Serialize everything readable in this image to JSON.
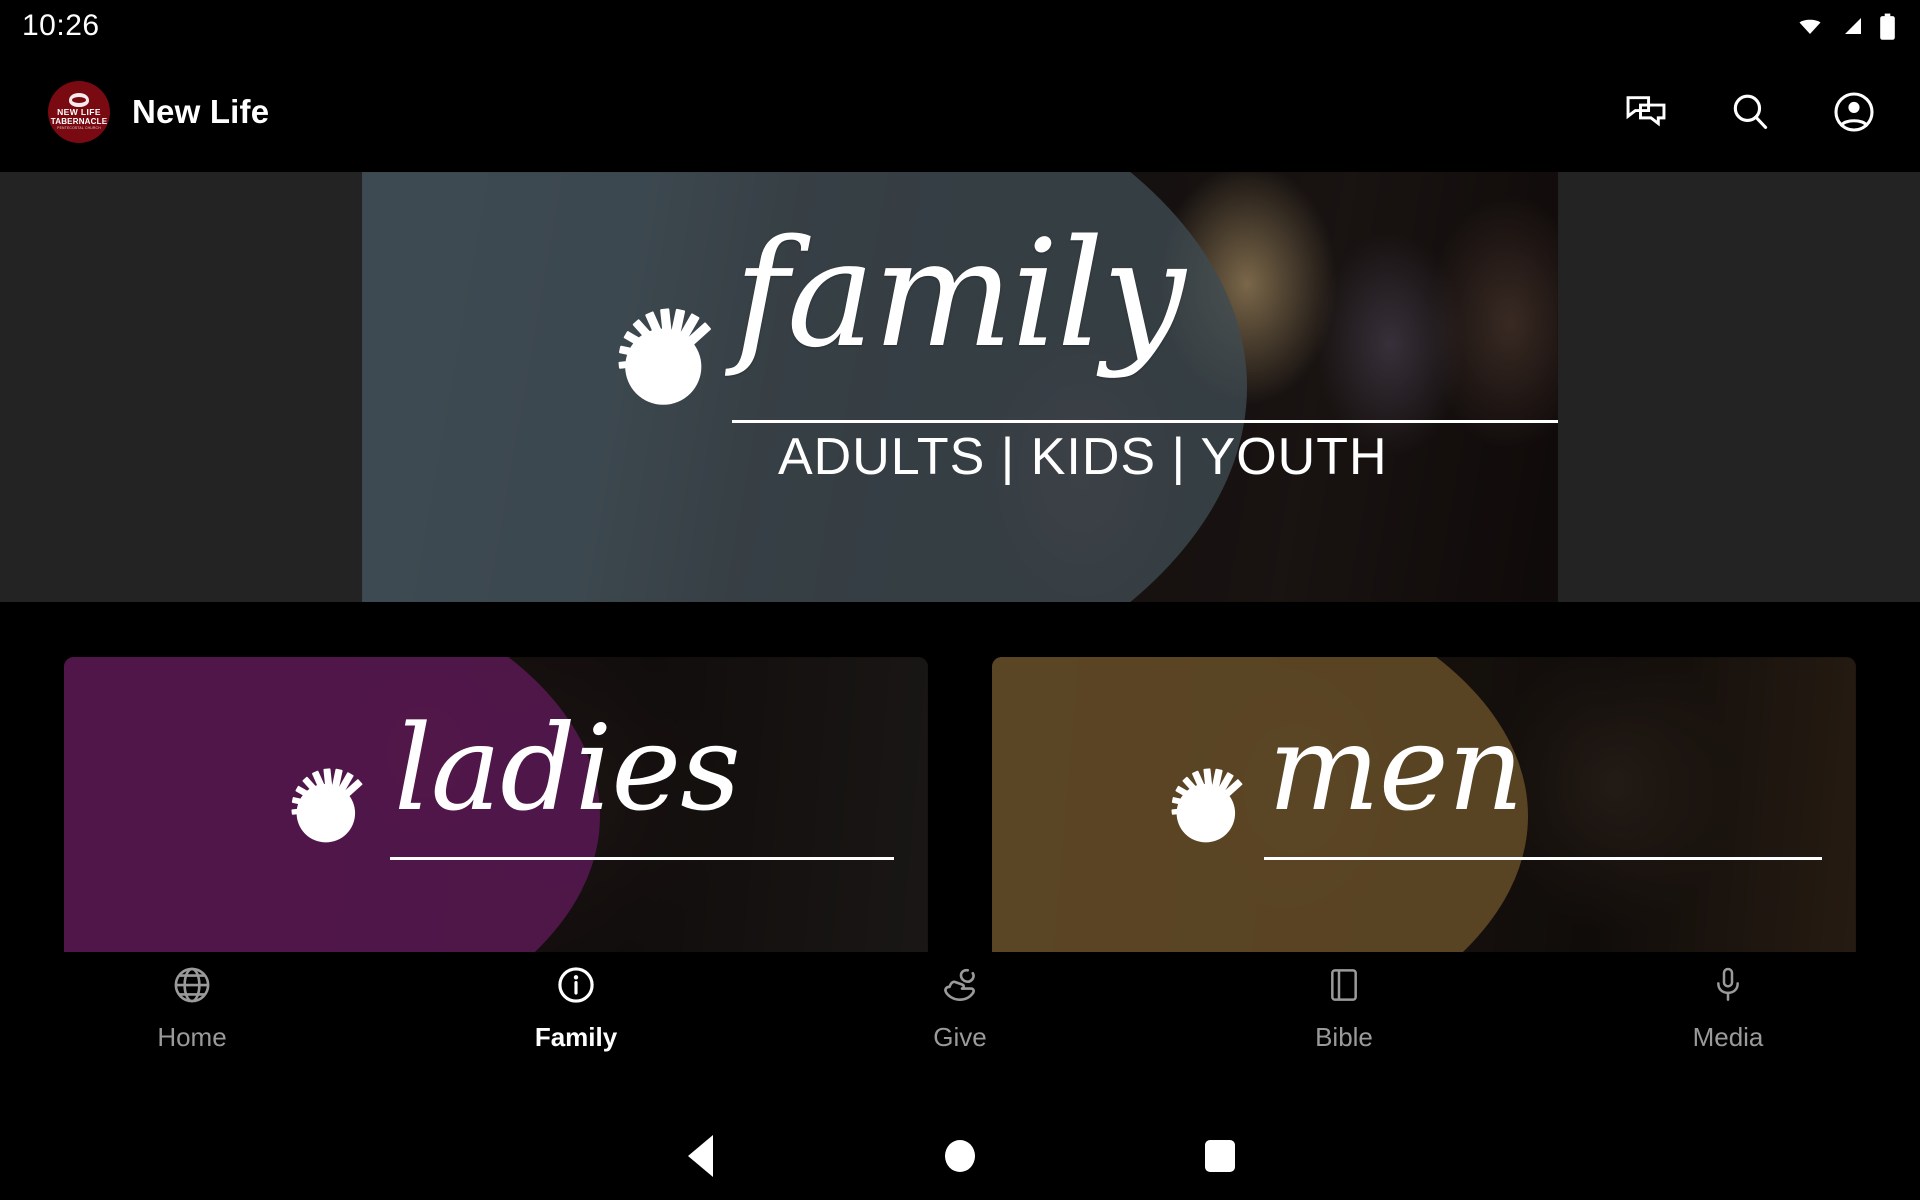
{
  "status_bar": {
    "time": "10:26",
    "icons": [
      "wifi-icon",
      "cellular-signal-icon",
      "battery-icon"
    ]
  },
  "app_bar": {
    "logo": {
      "name": "new-life-tabernacle-logo",
      "line1": "NEW LIFE",
      "line2": "TABERNACLE",
      "line3": "PENTECOSTAL CHURCH",
      "color": "#7A0A12"
    },
    "title": "New Life",
    "actions": [
      {
        "name": "chat-icon",
        "label": "Chat"
      },
      {
        "name": "search-icon",
        "label": "Search"
      },
      {
        "name": "account-circle-icon",
        "label": "Account"
      }
    ]
  },
  "hero": {
    "name": "family-banner",
    "script_title": "family",
    "subtitle": "ADULTS | KIDS | YOUTH",
    "overlay_color": "#5a6b76",
    "background_color": "#232323"
  },
  "cards": [
    {
      "name": "ladies-card",
      "script_title": "ladies",
      "tint_color": "#7b2270"
    },
    {
      "name": "men-card",
      "script_title": "men",
      "tint_color": "#8a6937"
    }
  ],
  "bottom_nav": {
    "items": [
      {
        "label": "Home",
        "icon": "globe-icon",
        "active": false
      },
      {
        "label": "Family",
        "icon": "info-circle-icon",
        "active": true
      },
      {
        "label": "Give",
        "icon": "giving-hand-icon",
        "active": false
      },
      {
        "label": "Bible",
        "icon": "book-icon",
        "active": false
      },
      {
        "label": "Media",
        "icon": "microphone-icon",
        "active": false
      }
    ],
    "active_color": "#ffffff",
    "inactive_color": "#9a9a9a"
  },
  "system_nav": {
    "back": "back-triangle-icon",
    "home": "home-circle-icon",
    "recents": "recents-square-icon"
  }
}
